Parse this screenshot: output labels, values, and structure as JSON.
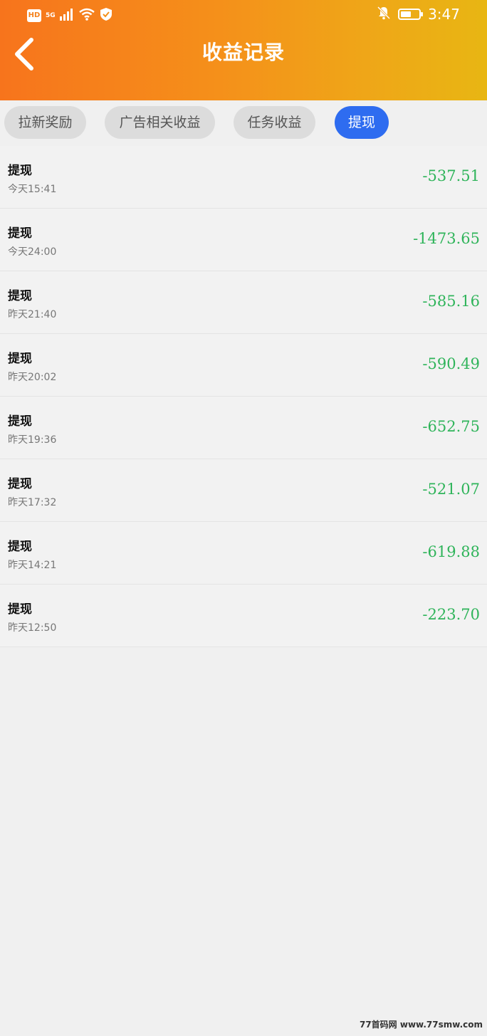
{
  "status_bar": {
    "hd": "HD",
    "network": "5G",
    "time": "3:47"
  },
  "header": {
    "title": "收益记录"
  },
  "tabs": [
    {
      "label": "拉新奖励",
      "active": false
    },
    {
      "label": "广告相关收益",
      "active": false
    },
    {
      "label": "任务收益",
      "active": false
    },
    {
      "label": "提现",
      "active": true
    }
  ],
  "records": [
    {
      "label": "提现",
      "time": "今天15:41",
      "amount": "-537.51"
    },
    {
      "label": "提现",
      "time": "今天24:00",
      "amount": "-1473.65"
    },
    {
      "label": "提现",
      "time": "昨天21:40",
      "amount": "-585.16"
    },
    {
      "label": "提现",
      "time": "昨天20:02",
      "amount": "-590.49"
    },
    {
      "label": "提现",
      "time": "昨天19:36",
      "amount": "-652.75"
    },
    {
      "label": "提现",
      "time": "昨天17:32",
      "amount": "-521.07"
    },
    {
      "label": "提现",
      "time": "昨天14:21",
      "amount": "-619.88"
    },
    {
      "label": "提现",
      "time": "昨天12:50",
      "amount": "-223.70"
    }
  ],
  "watermark": "77首码网 www.77smw.com",
  "colors": {
    "accent_blue": "#2e6cf0",
    "amount_green": "#2fb45a",
    "header_start": "#f7741c",
    "header_end": "#e8b613"
  }
}
